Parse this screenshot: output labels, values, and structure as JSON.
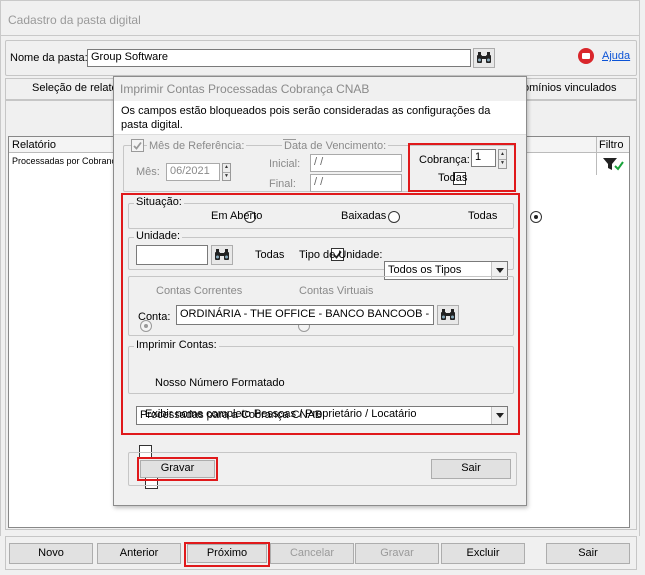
{
  "window": {
    "title": "Cadastro da pasta digital"
  },
  "main": {
    "pasta_label": "Nome da pasta:",
    "pasta_value": "Group Software",
    "help_label": "Ajuda",
    "tab_left": "Seleção de relató",
    "tab_right": "omínios vinculados",
    "grid": {
      "col_relatorio": "Relatório",
      "col_filtro": "Filtro",
      "row1": "Processadas por Cobranç"
    }
  },
  "dialog": {
    "title": "Imprimir Contas Processadas Cobrança CNAB",
    "info": "Os campos estão bloqueados pois serão consideradas as configurações da pasta digital.",
    "mes_ref_label": "Mês de Referência:",
    "mes_label": "Mês:",
    "mes_value": "06/2021",
    "data_venc_label": "Data de Vencimento:",
    "inicial_label": "Inicial:",
    "inicial_value": " / /",
    "final_label": "Final:",
    "final_value": " / /",
    "cobranca_label": "Cobrança:",
    "cobranca_value": "1",
    "todas_cobranca_label": "Todas",
    "situacao": {
      "legend": "Situação:",
      "opt1": "Em Aberto",
      "opt2": "Baixadas",
      "opt3": "Todas",
      "selected": "Todas"
    },
    "unidade": {
      "legend": "Unidade:",
      "value": "",
      "todas_label": "Todas",
      "tipo_label": "Tipo de Unidade:",
      "tipo_value": "Todos os Tipos"
    },
    "contas": {
      "opt1": "Contas Correntes",
      "opt2": "Contas Virtuais",
      "conta_label": "Conta:",
      "conta_value": "ORDINÁRIA - THE OFFICE - BANCO BANCOOB - Nº"
    },
    "imprimir": {
      "legend": "Imprimir Contas:",
      "value": "Processadas para a Cobrança CNAB",
      "nosso_numero_label": "Nosso Número Formatado"
    },
    "exibir_nome_label": "Exibir nome completo Pessoas / Proprietário / Locatário",
    "gravar_label": "Gravar",
    "sair_label": "Sair"
  },
  "toolbar": {
    "novo": "Novo",
    "anterior": "Anterior",
    "proximo": "Próximo",
    "cancelar": "Cancelar",
    "gravar": "Gravar",
    "excluir": "Excluir",
    "sair": "Sair"
  },
  "colors": {
    "highlight": "#e0191b",
    "link": "#0b53d6",
    "help_icon": "#d9262b"
  },
  "icons": [
    "binoculars-icon",
    "help-icon",
    "filter-icon",
    "dropdown-arrow-icon",
    "spin-arrows-icon"
  ]
}
